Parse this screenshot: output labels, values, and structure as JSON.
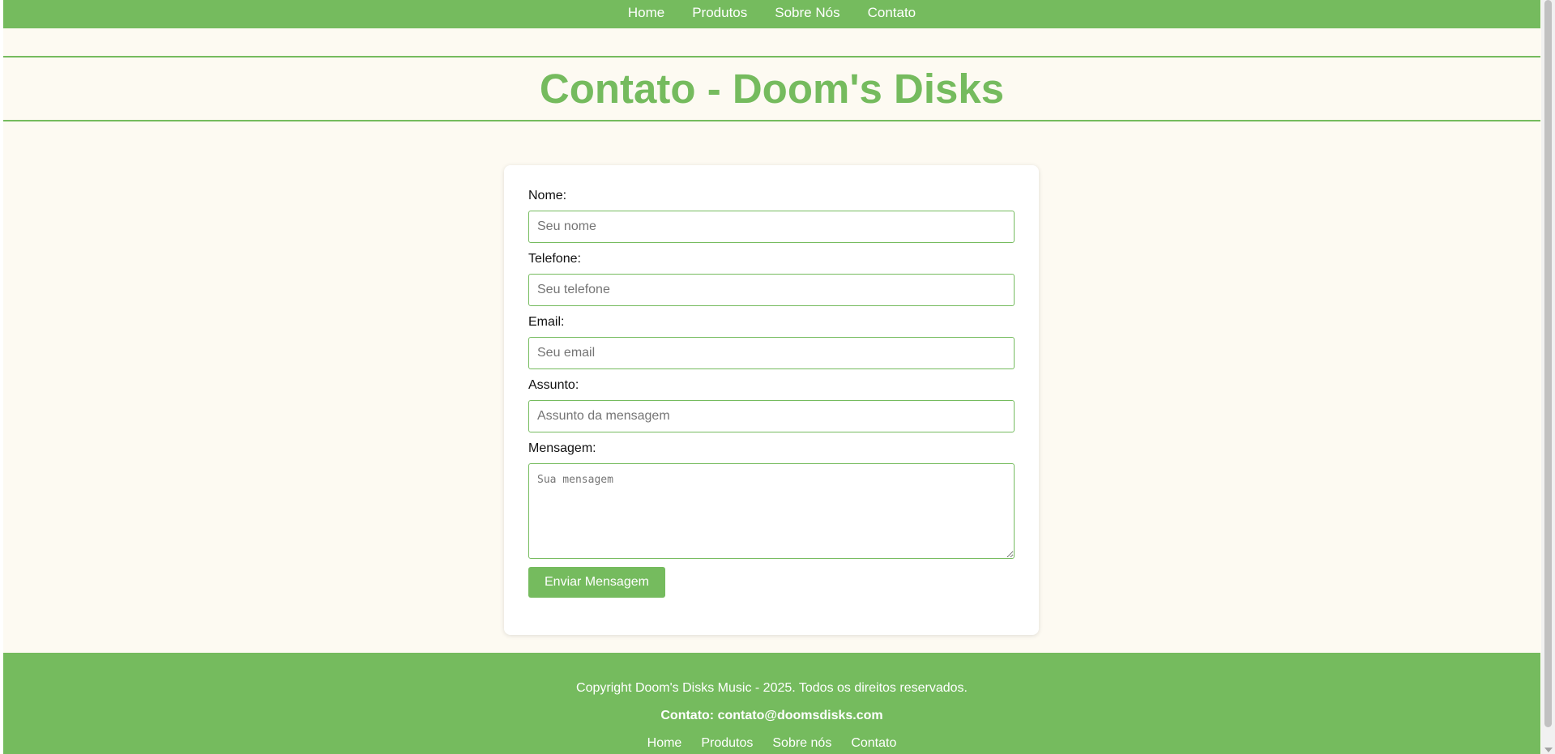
{
  "nav": {
    "items": [
      "Home",
      "Produtos",
      "Sobre Nós",
      "Contato"
    ]
  },
  "header": {
    "title": "Contato - Doom's Disks"
  },
  "form": {
    "fields": [
      {
        "label": "Nome:",
        "placeholder": "Seu nome"
      },
      {
        "label": "Telefone:",
        "placeholder": "Seu telefone"
      },
      {
        "label": "Email:",
        "placeholder": "Seu email"
      },
      {
        "label": "Assunto:",
        "placeholder": "Assunto da mensagem"
      }
    ],
    "message": {
      "label": "Mensagem:",
      "placeholder": "Sua mensagem"
    },
    "submit_label": "Enviar Mensagem"
  },
  "footer": {
    "copyright": "Copyright Doom's Disks Music - 2025. Todos os direitos reservados.",
    "contact": "Contato: contato@doomsdisks.com",
    "links": [
      "Home",
      "Produtos",
      "Sobre nós",
      "Contato"
    ]
  },
  "colors": {
    "accent": "#75bb5e",
    "background": "#fdfaf2",
    "card": "#ffffff"
  }
}
